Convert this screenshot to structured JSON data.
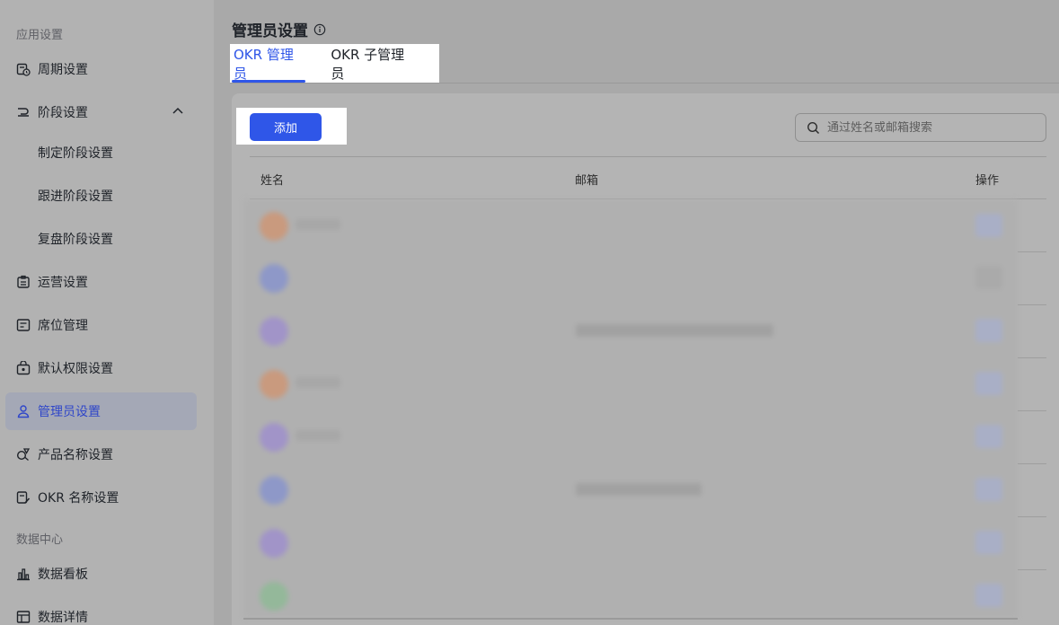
{
  "sidebar": {
    "section_app": "应用设置",
    "section_data": "数据中心",
    "items": {
      "cycle": "周期设置",
      "stage": "阶段设置",
      "stage_define": "制定阶段设置",
      "stage_follow": "跟进阶段设置",
      "stage_review": "复盘阶段设置",
      "operation": "运营设置",
      "seat": "席位管理",
      "permission": "默认权限设置",
      "admin": "管理员设置",
      "product_name": "产品名称设置",
      "okr_name": "OKR 名称设置",
      "dashboard": "数据看板",
      "details": "数据详情"
    }
  },
  "main": {
    "title": "管理员设置",
    "tabs": {
      "okr_admin": "OKR 管理员",
      "okr_sub_admin": "OKR 子管理员"
    },
    "add_button": "添加",
    "search_placeholder": "通过姓名或邮箱搜索",
    "columns": {
      "name": "姓名",
      "email": "邮箱",
      "action": "操作"
    }
  },
  "colors": {
    "accent": "#2f56e8",
    "active_nav_bg": "#a4a8b6"
  }
}
